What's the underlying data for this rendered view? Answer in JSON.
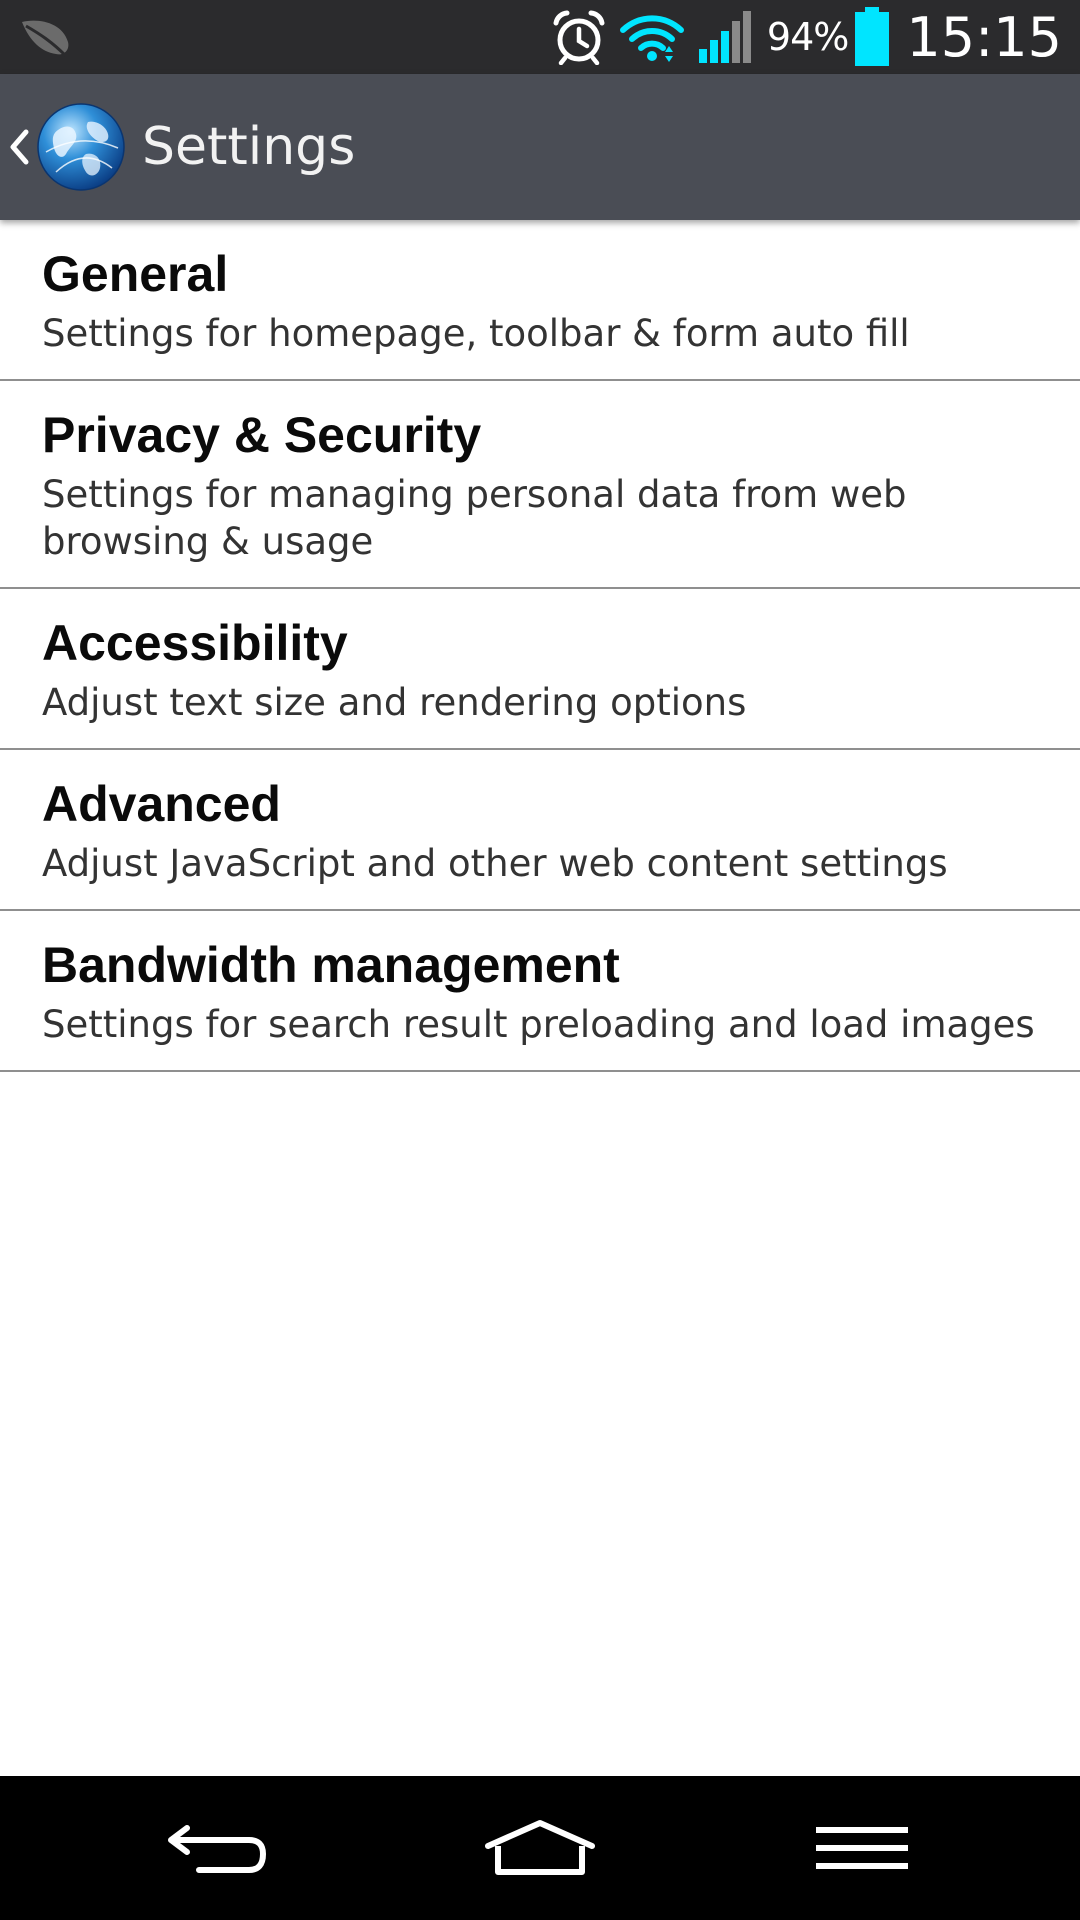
{
  "status_bar": {
    "notification_icon": "leaf-icon",
    "alarm_icon": "alarm-clock-icon",
    "wifi_icon": "wifi-icon",
    "signal_icon": "signal-strength-icon",
    "battery_percent": "94%",
    "battery_icon": "battery-icon",
    "time": "15:15",
    "accent_color": "#00e5ff"
  },
  "action_bar": {
    "back_icon": "chevron-left-icon",
    "app_icon": "globe-icon",
    "title": "Settings"
  },
  "settings": {
    "items": [
      {
        "title": "General",
        "summary": "Settings for homepage, toolbar & form auto fill"
      },
      {
        "title": "Privacy & Security",
        "summary": "Settings for managing personal data from web browsing & usage"
      },
      {
        "title": "Accessibility",
        "summary": "Adjust text size and rendering options"
      },
      {
        "title": "Advanced",
        "summary": "Adjust JavaScript and other web content settings"
      },
      {
        "title": "Bandwidth management",
        "summary": "Settings for search result preloading and load images"
      }
    ]
  },
  "nav_bar": {
    "back_icon": "back-arrow-icon",
    "home_icon": "home-icon",
    "menu_icon": "menu-icon"
  }
}
